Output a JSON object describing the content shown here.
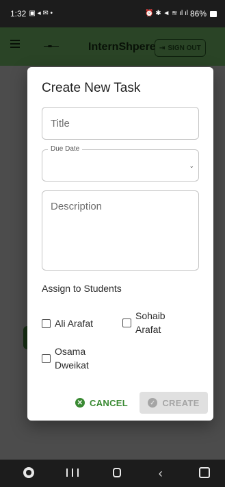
{
  "status_bar": {
    "time": "1:32",
    "battery": "86%"
  },
  "app_bar": {
    "title": "InternShpere",
    "sign_out_label": "SIGN OUT"
  },
  "dialog": {
    "title": "Create New Task",
    "title_placeholder": "Title",
    "title_value": "",
    "due_date_label": "Due Date",
    "due_date_value": "",
    "description_placeholder": "Description",
    "description_value": "",
    "assign_label": "Assign to Students",
    "students": [
      {
        "name_line1": "Ali Arafat",
        "name_line2": "",
        "checked": false
      },
      {
        "name_line1": "Sohaib",
        "name_line2": "Arafat",
        "checked": false
      },
      {
        "name_line1": "Osama",
        "name_line2": "Dweikat",
        "checked": false
      }
    ],
    "cancel_label": "CANCEL",
    "create_label": "CREATE"
  },
  "colors": {
    "app_bar": "#4e7d46",
    "accent_green": "#3a8a33",
    "disabled_bg": "#e0e0e0",
    "disabled_text": "#a5a5a5"
  },
  "icons": {
    "menu": "menu-icon",
    "logo": "logo-icon",
    "sign_out": "logout-icon",
    "cancel": "cancel-icon",
    "create": "check-circle-icon",
    "dropdown": "chevron-down-icon"
  }
}
